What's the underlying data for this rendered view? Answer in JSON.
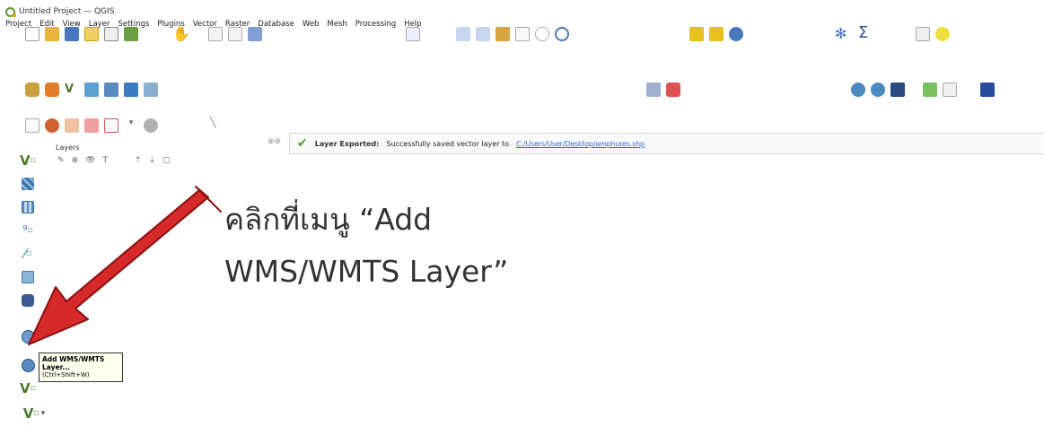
{
  "window": {
    "title": "Untitled Project — QGIS"
  },
  "menubar": {
    "items": [
      "Project",
      "Edit",
      "View",
      "Layer",
      "Settings",
      "Plugins",
      "Vector",
      "Raster",
      "Database",
      "Web",
      "Mesh",
      "Processing",
      "Help"
    ]
  },
  "layers_panel": {
    "title": "Layers"
  },
  "message_bar": {
    "title": "Layer Exported:",
    "text": "Successfully saved vector layer to",
    "path": "C:/Users/User/Desktop/amphures.shp"
  },
  "annotation": {
    "line1": "คลิกที่เมนู “Add",
    "line2": "WMS/WMTS Layer”"
  },
  "tooltip": {
    "title": "Add WMS/WMTS",
    "title2": "Layer...",
    "shortcut": "(Ctrl+Shift+W)"
  },
  "colors": {
    "arrow": "#d62a2a",
    "arrow_outline": "#8a1010",
    "accent_green": "#5c9a2e",
    "link_blue": "#2a6fd8"
  }
}
